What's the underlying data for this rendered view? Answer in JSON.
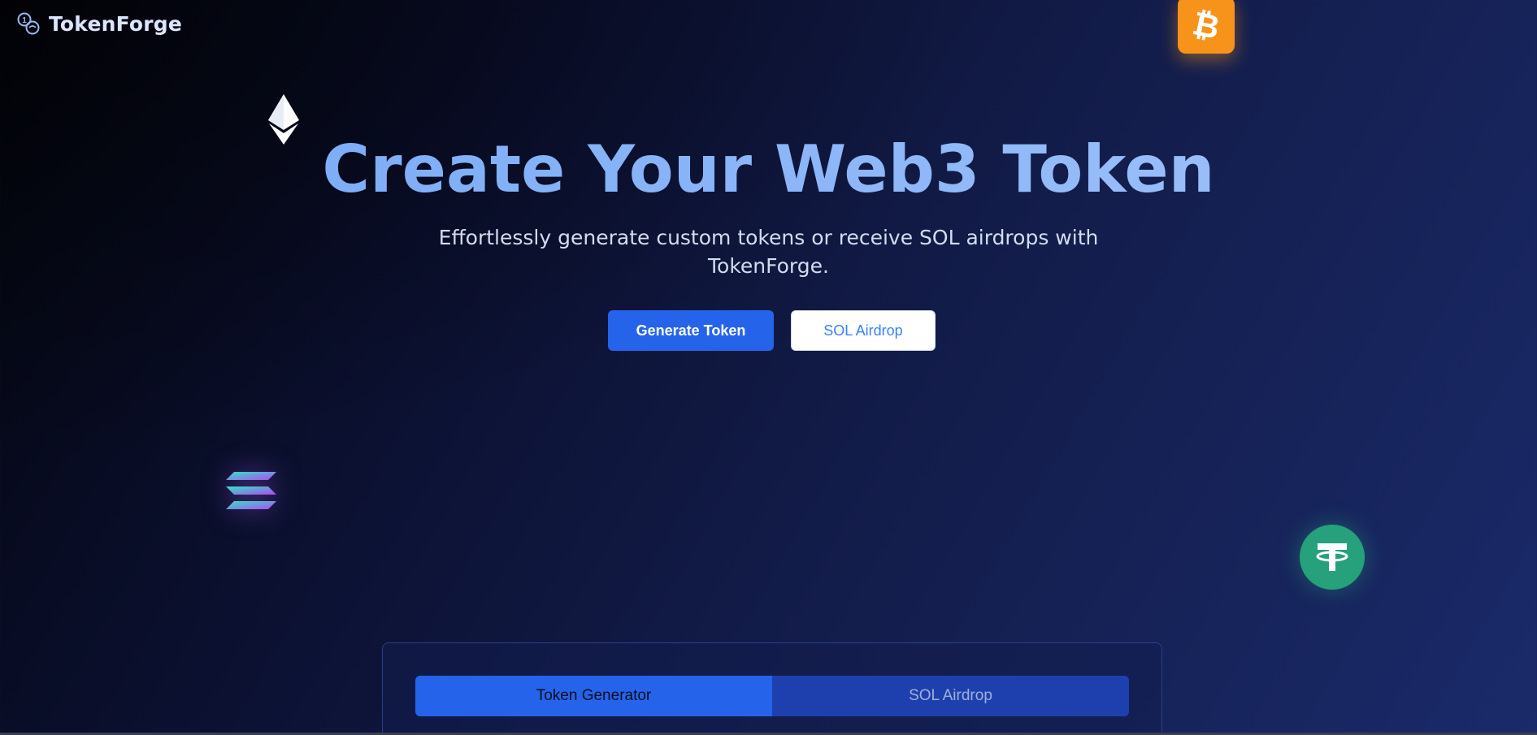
{
  "brand": {
    "name": "TokenForge",
    "logo_icon": "coins-icon"
  },
  "hero": {
    "title": "Create Your Web3 Token",
    "subtitle_line1": "Effortlessly generate custom tokens or receive SOL airdrops with",
    "subtitle_line2": "TokenForge."
  },
  "cta": {
    "primary_label": "Generate Token",
    "secondary_label": "SOL Airdrop"
  },
  "floating_icons": [
    "bitcoin-icon",
    "ethereum-icon",
    "solana-icon",
    "tether-icon"
  ],
  "panel": {
    "tabs": [
      {
        "label": "Token Generator",
        "active": true
      },
      {
        "label": "SOL Airdrop",
        "active": false
      }
    ]
  },
  "colors": {
    "accent": "#2563eb",
    "title_gradient_start": "#74a8f5",
    "title_gradient_end": "#a2c3fa",
    "bitcoin": "#f7931a",
    "tether": "#26a17b"
  }
}
